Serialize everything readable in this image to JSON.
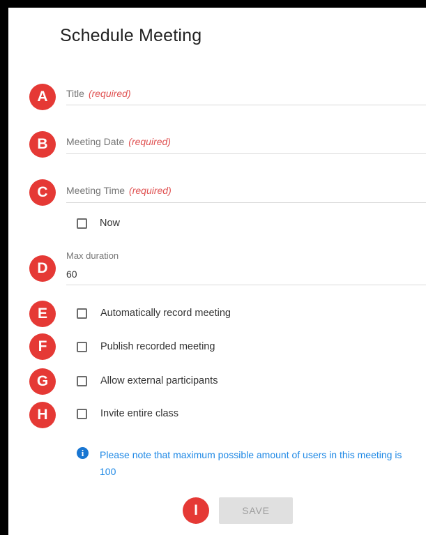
{
  "header": {
    "title": "Schedule Meeting"
  },
  "badges": [
    "A",
    "B",
    "C",
    "D",
    "E",
    "F",
    "G",
    "H",
    "I"
  ],
  "fields": {
    "title": {
      "label": "Title",
      "required": "(required)"
    },
    "meeting_date": {
      "label": "Meeting Date",
      "required": "(required)"
    },
    "meeting_time": {
      "label": "Meeting Time",
      "required": "(required)"
    },
    "max_duration": {
      "label": "Max duration",
      "value": "60"
    }
  },
  "checkboxes": {
    "now": "Now",
    "auto_record": "Automatically record meeting",
    "publish_recorded": "Publish recorded meeting",
    "allow_external": "Allow external participants",
    "invite_class": "Invite entire class"
  },
  "info": {
    "icon": "info-icon",
    "text": "Please note that maximum possible amount of users in this meeting is 100"
  },
  "actions": {
    "save_label": "SAVE"
  },
  "colors": {
    "badge": "#e53935",
    "required": "#e05252",
    "info": "#1e88e5",
    "save_bg": "#e0e0e0"
  }
}
